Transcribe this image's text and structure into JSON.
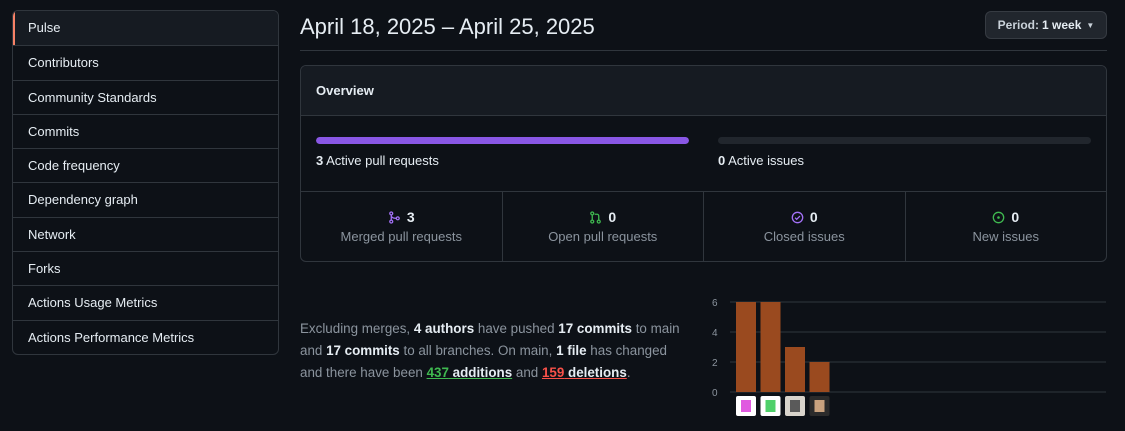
{
  "sidebar": {
    "items": [
      {
        "label": "Pulse",
        "active": true
      },
      {
        "label": "Contributors"
      },
      {
        "label": "Community Standards"
      },
      {
        "label": "Commits"
      },
      {
        "label": "Code frequency"
      },
      {
        "label": "Dependency graph"
      },
      {
        "label": "Network"
      },
      {
        "label": "Forks"
      },
      {
        "label": "Actions Usage Metrics"
      },
      {
        "label": "Actions Performance Metrics"
      }
    ]
  },
  "header": {
    "date_range": "April 18, 2025 – April 25, 2025",
    "period_prefix": "Period:",
    "period_value": "1 week"
  },
  "overview": {
    "title": "Overview",
    "active_prs": {
      "count": "3",
      "label": "Active pull requests",
      "fill_fraction": 1.0,
      "color": "#8957e5"
    },
    "active_issues": {
      "count": "0",
      "label": "Active issues",
      "fill_fraction": 0
    },
    "stats": [
      {
        "icon": "merge-icon",
        "count": "3",
        "label": "Merged pull requests",
        "color": "#a371f7"
      },
      {
        "icon": "pull-request-icon",
        "count": "0",
        "label": "Open pull requests",
        "color": "#3fb950"
      },
      {
        "icon": "check-circle-icon",
        "count": "0",
        "label": "Closed issues",
        "color": "#a371f7"
      },
      {
        "icon": "dot-circle-icon",
        "count": "0",
        "label": "New issues",
        "color": "#3fb950"
      }
    ]
  },
  "summary": {
    "t1": "Excluding merges, ",
    "authors": "4 authors",
    "t2": " have pushed ",
    "commits_main": "17 commits",
    "t3": " to main and ",
    "commits_all": "17 commits",
    "t4": " to all branches. On main, ",
    "files": "1 file",
    "t5": " has changed and there have been ",
    "additions_num": "437",
    "additions_word": " additions",
    "t6": " and ",
    "deletions_num": "159",
    "deletions_word": " deletions",
    "t7": "."
  },
  "chart_data": {
    "type": "bar",
    "categories": [
      "author-1",
      "author-2",
      "author-3",
      "author-4"
    ],
    "values": [
      6,
      6,
      3,
      2
    ],
    "ylim": [
      0,
      6
    ],
    "yticks": [
      "0",
      "2",
      "4",
      "6"
    ],
    "bar_color": "#9a4a1f",
    "grid": true
  }
}
